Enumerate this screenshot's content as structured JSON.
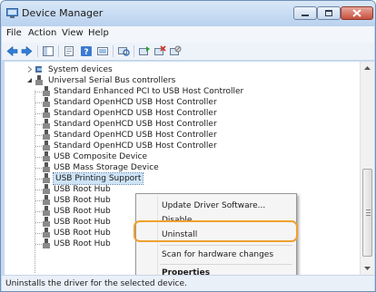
{
  "window": {
    "title": "Device Manager"
  },
  "menu": [
    "File",
    "Action",
    "View",
    "Help"
  ],
  "toolbar_icons": [
    "back-arrow-icon",
    "forward-arrow-icon",
    "show-hide-console-tree-icon",
    "properties-icon",
    "help-icon",
    "view-icon",
    "scan-hardware-icon",
    "update-driver-icon",
    "uninstall-icon",
    "disable-icon"
  ],
  "tree": {
    "system_devices": "System devices",
    "usb_controllers": "Universal Serial Bus controllers",
    "children": [
      "Standard Enhanced PCI to USB Host Controller",
      "Standard OpenHCD USB Host Controller",
      "Standard OpenHCD USB Host Controller",
      "Standard OpenHCD USB Host Controller",
      "Standard OpenHCD USB Host Controller",
      "Standard OpenHCD USB Host Controller",
      "USB Composite Device",
      "USB Mass Storage Device",
      "USB Printing Support",
      "USB Root Hub",
      "USB Root Hub",
      "USB Root Hub",
      "USB Root Hub",
      "USB Root Hub",
      "USB Root Hub"
    ],
    "selected_index": 8
  },
  "context_menu": {
    "update": "Update Driver Software...",
    "disable": "Disable",
    "uninstall": "Uninstall",
    "scan": "Scan for hardware changes",
    "properties": "Properties",
    "highlighted": "Uninstall"
  },
  "status": "Uninstalls the driver for the selected device.",
  "colors": {
    "highlight_outline": "#f0a030",
    "selection": "#cde3f7"
  }
}
